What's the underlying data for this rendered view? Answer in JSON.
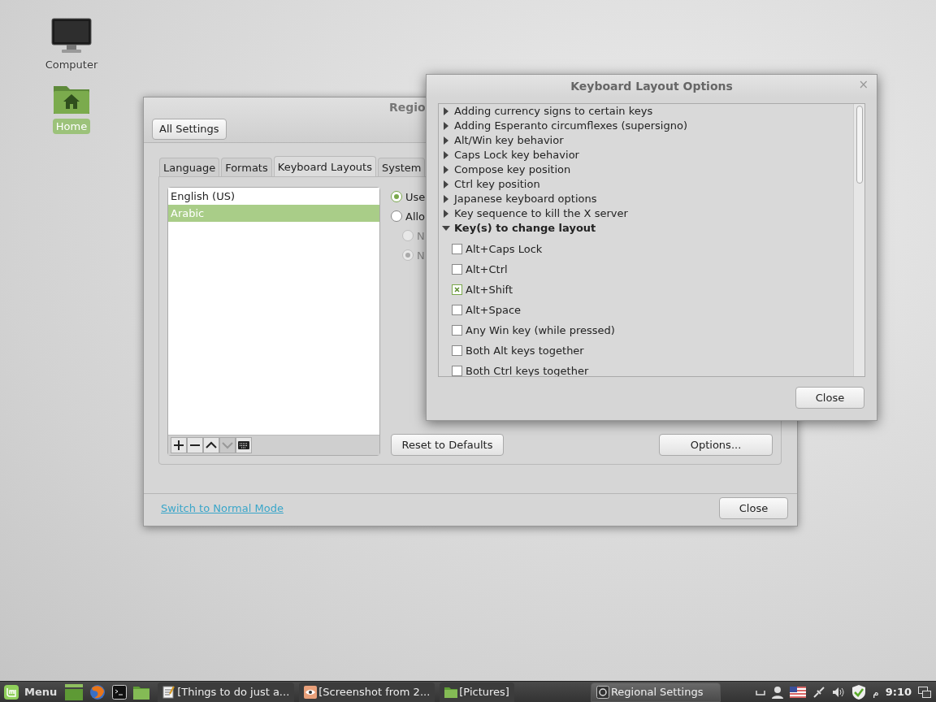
{
  "desktop_icons": [
    {
      "label": "Computer",
      "kind": "computer",
      "selected": false
    },
    {
      "label": "Home",
      "kind": "home",
      "selected": true
    }
  ],
  "regional_window": {
    "title": "Regio",
    "all_settings": "All Settings",
    "tabs": [
      {
        "label": "Language",
        "selected": false
      },
      {
        "label": "Formats",
        "selected": false
      },
      {
        "label": "Keyboard Layouts",
        "selected": true
      },
      {
        "label": "System",
        "selected": false
      }
    ],
    "layouts": [
      {
        "label": "English (US)",
        "selected": false
      },
      {
        "label": "Arabic",
        "selected": true
      }
    ],
    "list_tools": [
      {
        "kind": "add",
        "disabled": false
      },
      {
        "kind": "remove",
        "disabled": false
      },
      {
        "kind": "up",
        "disabled": false
      },
      {
        "kind": "down",
        "disabled": true
      },
      {
        "kind": "keyboard",
        "disabled": false
      }
    ],
    "radios": [
      {
        "label": "Use",
        "selected": true,
        "disabled": false
      },
      {
        "label": "Allo",
        "selected": false,
        "disabled": false,
        "children": [
          {
            "label": "N",
            "selected": false,
            "disabled": true
          },
          {
            "label": "N",
            "selected": true,
            "disabled": true
          }
        ]
      }
    ],
    "reset_button": "Reset to Defaults",
    "options_button": "Options...",
    "mode_link": "Switch to Normal Mode",
    "close_button": "Close"
  },
  "options_dialog": {
    "title": "Keyboard Layout Options",
    "close_glyph": "×",
    "tree": [
      {
        "label": "Adding currency signs to certain keys",
        "expanded": false
      },
      {
        "label": "Adding Esperanto circumflexes (supersigno)",
        "expanded": false
      },
      {
        "label": "Alt/Win key behavior",
        "expanded": false
      },
      {
        "label": "Caps Lock key behavior",
        "expanded": false
      },
      {
        "label": "Compose key position",
        "expanded": false
      },
      {
        "label": "Ctrl key position",
        "expanded": false
      },
      {
        "label": "Japanese keyboard options",
        "expanded": false
      },
      {
        "label": "Key sequence to kill the X server",
        "expanded": false
      },
      {
        "label": "Key(s) to change layout",
        "expanded": true,
        "children": [
          {
            "label": "Alt+Caps Lock",
            "checked": false
          },
          {
            "label": "Alt+Ctrl",
            "checked": false
          },
          {
            "label": "Alt+Shift",
            "checked": true
          },
          {
            "label": "Alt+Space",
            "checked": false
          },
          {
            "label": "Any Win key (while pressed)",
            "checked": false
          },
          {
            "label": "Both Alt keys together",
            "checked": false
          },
          {
            "label": "Both Ctrl keys together",
            "checked": false
          }
        ]
      }
    ],
    "close_button": "Close"
  },
  "taskbar": {
    "menu_label": "Menu",
    "launchers": [
      {
        "kind": "desktop"
      },
      {
        "kind": "browser"
      },
      {
        "kind": "terminal"
      },
      {
        "kind": "folder"
      }
    ],
    "tasks": [
      {
        "label": "[Things to do just a...",
        "kind": "editor",
        "selected": false
      },
      {
        "label": "[Screenshot from 2...",
        "kind": "viewer",
        "selected": false
      },
      {
        "label": "[Pictures]",
        "kind": "folder",
        "selected": false
      },
      {
        "label": "Regional Settings",
        "kind": "settings",
        "selected": true
      }
    ],
    "layout_indicator": "م",
    "clock": "9:10"
  }
}
